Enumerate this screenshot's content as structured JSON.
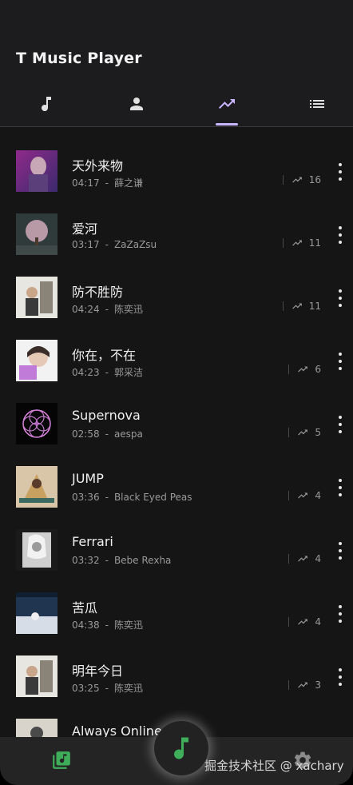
{
  "app": {
    "title": "T Music Player"
  },
  "tabs": [
    {
      "icon": "music-note-icon",
      "active": false
    },
    {
      "icon": "person-icon",
      "active": false
    },
    {
      "icon": "trending-up-icon",
      "active": true
    },
    {
      "icon": "list-icon",
      "active": false
    }
  ],
  "colors": {
    "accent": "#c9b6ff",
    "fab_green": "#3fae5a",
    "background": "#151515",
    "header": "#1c1c1e"
  },
  "songs": [
    {
      "title": "天外来物",
      "duration": "04:17",
      "artist": "薛之谦",
      "plays": "16"
    },
    {
      "title": "爱河",
      "duration": "03:17",
      "artist": "ZaZaZsu",
      "plays": "11"
    },
    {
      "title": "防不胜防",
      "duration": "04:24",
      "artist": "陈奕迅",
      "plays": "11"
    },
    {
      "title": "你在，不在",
      "duration": "04:23",
      "artist": "郭采洁",
      "plays": "6"
    },
    {
      "title": "Supernova",
      "duration": "02:58",
      "artist": "aespa",
      "plays": "5"
    },
    {
      "title": "JUMP",
      "duration": "03:36",
      "artist": "Black Eyed Peas",
      "plays": "4"
    },
    {
      "title": "Ferrari",
      "duration": "03:32",
      "artist": "Bebe Rexha",
      "plays": "4"
    },
    {
      "title": "苦瓜",
      "duration": "04:38",
      "artist": "陈奕迅",
      "plays": "4"
    },
    {
      "title": "明年今日",
      "duration": "03:25",
      "artist": "陈奕迅",
      "plays": "3"
    },
    {
      "title": "Always Online",
      "duration": "",
      "artist": "",
      "plays": ""
    }
  ],
  "meta_separator": "-",
  "bottom_bar": {
    "left_icon": "music-library-icon",
    "center_icon": "music-note-icon",
    "right_icon": "gear-icon",
    "watermark": "掘金技术社区 @ xachary"
  }
}
